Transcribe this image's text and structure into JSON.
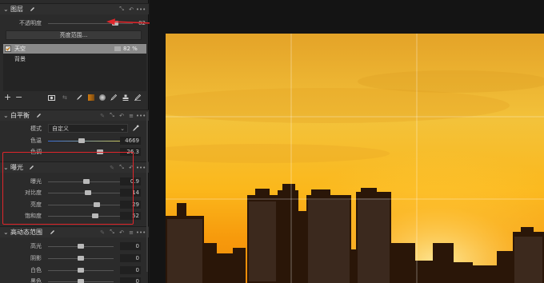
{
  "layers": {
    "title": "图层",
    "opacity_label": "不透明度",
    "opacity_value": "82",
    "opacity_level": 0.82,
    "luminosity_button": "亮度范围...",
    "items": [
      {
        "name": "天空",
        "percent": "82 %",
        "checked": true,
        "selected": true
      },
      {
        "name": "背景",
        "percent": "",
        "checked": false,
        "selected": false
      }
    ],
    "add_label": "+",
    "remove_label": "−"
  },
  "white_balance": {
    "title": "白平衡",
    "mode_label": "模式",
    "mode_value": "自定义",
    "temp_label": "色温",
    "temp_value": "4669",
    "tint_label": "色调",
    "tint_value": "26.3"
  },
  "exposure": {
    "title": "曝光",
    "rows": [
      {
        "label": "曝光",
        "value": "0.9"
      },
      {
        "label": "对比度",
        "value": "14"
      },
      {
        "label": "亮度",
        "value": "29"
      },
      {
        "label": "饱和度",
        "value": "52"
      }
    ]
  },
  "hdr": {
    "title": "高动态范围",
    "rows": [
      {
        "label": "高光",
        "value": "0"
      },
      {
        "label": "阴影",
        "value": "0"
      },
      {
        "label": "白色",
        "value": "0"
      },
      {
        "label": "黑色",
        "value": "0"
      }
    ]
  },
  "colors": {
    "accent_red": "#e0262b",
    "selected_row": "#8a8a8a",
    "panel_bg": "#2b2b2b"
  }
}
